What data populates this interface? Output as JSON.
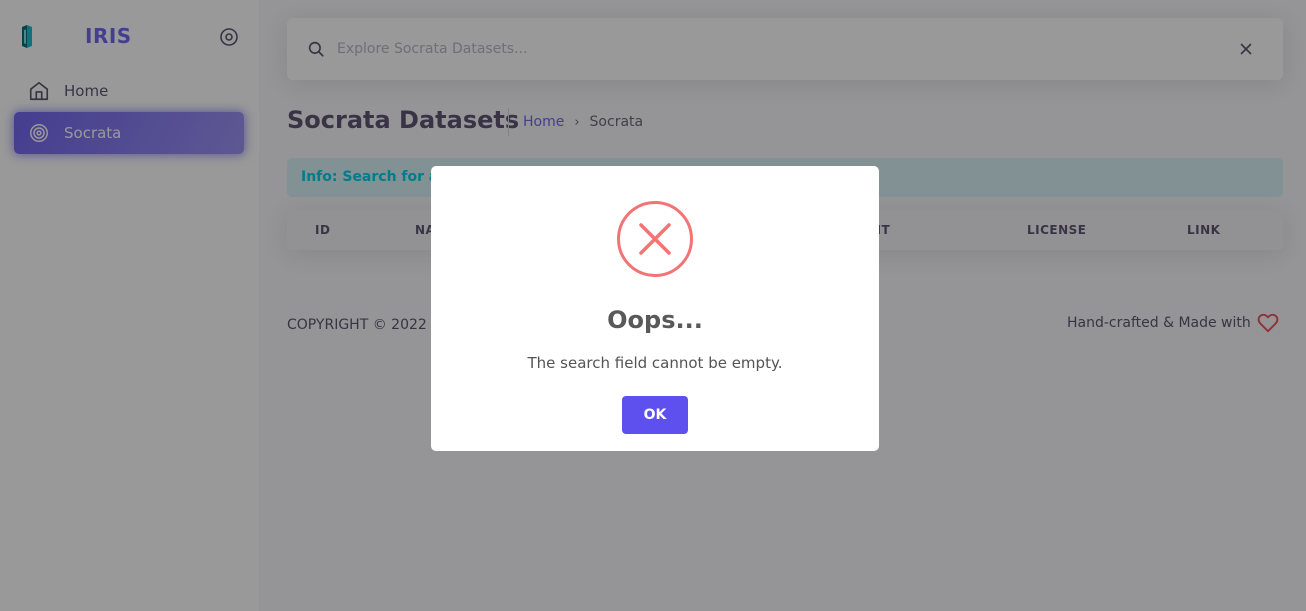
{
  "sidebar": {
    "brand_name": "IRIS",
    "items": [
      {
        "label": "Home",
        "icon": "home-icon",
        "active": false
      },
      {
        "label": "Socrata",
        "icon": "target-icon",
        "active": true
      }
    ]
  },
  "search": {
    "placeholder": "Explore Socrata Datasets...",
    "value": ""
  },
  "page": {
    "title": "Socrata Datasets",
    "breadcrumb": {
      "home": "Home",
      "separator": "›",
      "current": "Socrata"
    }
  },
  "info_alert": {
    "text": "Info: Search for a d"
  },
  "table": {
    "columns": [
      "ID",
      "NA",
      "NT",
      "LICENSE",
      "LINK"
    ]
  },
  "footer": {
    "left": "COPYRIGHT © 2022",
    "right": "Hand-crafted & Made with"
  },
  "modal": {
    "title": "Oops...",
    "message": "The search field cannot be empty.",
    "ok_label": "OK",
    "icon": "error-x-icon"
  },
  "colors": {
    "primary": "#7367f0",
    "info": "#00cfe8",
    "danger": "#ea5455",
    "error_icon": "#f27474",
    "ok_button": "#5e50ee"
  }
}
